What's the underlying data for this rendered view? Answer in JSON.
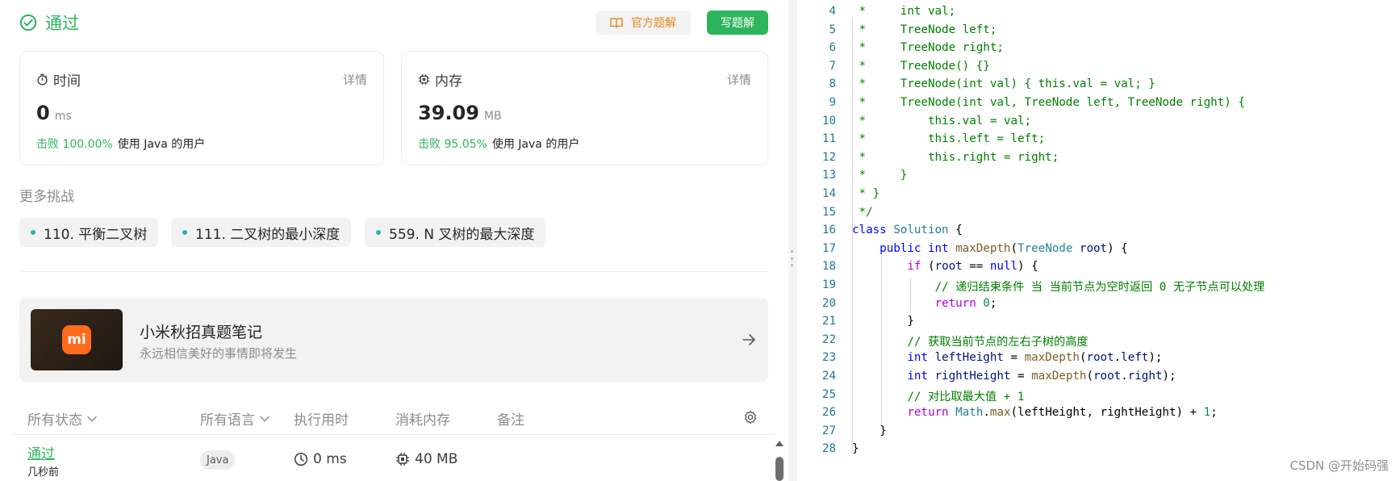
{
  "result": {
    "status": "通过",
    "official_solution_label": "官方题解",
    "write_solution_label": "写题解"
  },
  "runtime_card": {
    "title": "时间",
    "detail": "详情",
    "value": "0",
    "unit": "ms",
    "beat_label": "击败 100.00%",
    "beat_suffix": "使用 Java 的用户"
  },
  "memory_card": {
    "title": "内存",
    "detail": "详情",
    "value": "39.09",
    "unit": "MB",
    "beat_label": "击败 95.05%",
    "beat_suffix": "使用 Java 的用户"
  },
  "more_challenges": {
    "title": "更多挑战",
    "items": [
      "110. 平衡二叉树",
      "111. 二叉树的最小深度",
      "559. N 叉树的最大深度"
    ]
  },
  "banner": {
    "logo_text": "mi",
    "title": "小米秋招真题笔记",
    "subtitle": "永远相信美好的事情即将发生"
  },
  "submissions": {
    "headers": [
      "所有状态",
      "所有语言",
      "执行用时",
      "消耗内存",
      "备注"
    ],
    "rows": [
      {
        "status": "通过",
        "time_ago": "几秒前",
        "language": "Java",
        "runtime": "0 ms",
        "memory": "40 MB"
      }
    ]
  },
  "code": {
    "first_line_number": 4,
    "lines": [
      [
        [
          "cm",
          " *     int val;"
        ]
      ],
      [
        [
          "cm",
          " *     TreeNode left;"
        ]
      ],
      [
        [
          "cm",
          " *     TreeNode right;"
        ]
      ],
      [
        [
          "cm",
          " *     TreeNode() {}"
        ]
      ],
      [
        [
          "cm",
          " *     TreeNode(int val) { this.val = val; }"
        ]
      ],
      [
        [
          "cm",
          " *     TreeNode(int val, TreeNode left, TreeNode right) {"
        ]
      ],
      [
        [
          "cm",
          " *         this.val = val;"
        ]
      ],
      [
        [
          "cm",
          " *         this.left = left;"
        ]
      ],
      [
        [
          "cm",
          " *         this.right = right;"
        ]
      ],
      [
        [
          "cm",
          " *     }"
        ]
      ],
      [
        [
          "cm",
          " * }"
        ]
      ],
      [
        [
          "cm",
          " */"
        ]
      ],
      [
        [
          "kw",
          "class"
        ],
        [
          "",
          " "
        ],
        [
          "ty",
          "Solution"
        ],
        [
          "",
          " {"
        ]
      ],
      [
        [
          "",
          "    "
        ],
        [
          "kw",
          "public"
        ],
        [
          "",
          " "
        ],
        [
          "kw",
          "int"
        ],
        [
          "",
          " "
        ],
        [
          "fn",
          "maxDepth"
        ],
        [
          "",
          "("
        ],
        [
          "ty",
          "TreeNode"
        ],
        [
          "",
          " "
        ],
        [
          "va",
          "root"
        ],
        [
          "",
          ") {"
        ]
      ],
      [
        [
          "",
          "        "
        ],
        [
          "ct",
          "if"
        ],
        [
          "",
          " ("
        ],
        [
          "va",
          "root"
        ],
        [
          "",
          " == "
        ],
        [
          "kw",
          "null"
        ],
        [
          "",
          ") {"
        ]
      ],
      [
        [
          "",
          "            "
        ],
        [
          "cm",
          "// 递归结束条件 当 当前节点为空时返回 0 无子节点可以处理"
        ]
      ],
      [
        [
          "",
          "            "
        ],
        [
          "ct",
          "return"
        ],
        [
          "",
          " "
        ],
        [
          "nu",
          "0"
        ],
        [
          "",
          ";"
        ]
      ],
      [
        [
          "",
          "        }"
        ]
      ],
      [
        [
          "",
          "        "
        ],
        [
          "cm",
          "// 获取当前节点的左右子树的高度"
        ]
      ],
      [
        [
          "",
          "        "
        ],
        [
          "kw",
          "int"
        ],
        [
          "",
          " "
        ],
        [
          "va",
          "leftHeight"
        ],
        [
          "",
          " = "
        ],
        [
          "fn",
          "maxDepth"
        ],
        [
          "",
          "("
        ],
        [
          "va",
          "root"
        ],
        [
          "",
          "."
        ],
        [
          "va",
          "left"
        ],
        [
          "",
          ");"
        ]
      ],
      [
        [
          "",
          "        "
        ],
        [
          "kw",
          "int"
        ],
        [
          "",
          " "
        ],
        [
          "va",
          "rightHeight"
        ],
        [
          "",
          " = "
        ],
        [
          "fn",
          "maxDepth"
        ],
        [
          "",
          "("
        ],
        [
          "va",
          "root"
        ],
        [
          "",
          "."
        ],
        [
          "va",
          "right"
        ],
        [
          "",
          ");"
        ]
      ],
      [
        [
          "",
          "        "
        ],
        [
          "cm",
          "// 对比取最大值 + 1"
        ]
      ],
      [
        [
          "",
          "        "
        ],
        [
          "ct",
          "return"
        ],
        [
          "",
          " "
        ],
        [
          "ty",
          "Math"
        ],
        [
          "",
          "."
        ],
        [
          "fn",
          "max"
        ],
        [
          "",
          "(leftHeight, rightHeight) + "
        ],
        [
          "nu",
          "1"
        ],
        [
          "",
          ";"
        ]
      ],
      [
        [
          "",
          "    }"
        ]
      ],
      [
        [
          "",
          "}"
        ]
      ]
    ]
  },
  "watermark": "CSDN @开始码强"
}
